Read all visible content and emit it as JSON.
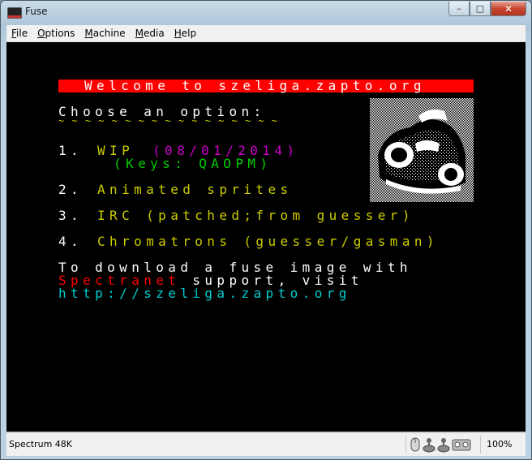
{
  "window": {
    "title": "Fuse",
    "controls": {
      "minimize": "–",
      "maximize": "□",
      "close": "✕"
    }
  },
  "menu": [
    {
      "label_first": "F",
      "label_rest": "ile"
    },
    {
      "label_first": "O",
      "label_rest": "ptions"
    },
    {
      "label_first": "M",
      "label_rest": "achine"
    },
    {
      "label_first": "M",
      "label_rest": "edia"
    },
    {
      "label_first": "H",
      "label_rest": "elp"
    }
  ],
  "screen": {
    "banner": "Welcome to szeliga.zapto.org",
    "prompt": "Choose an option:",
    "prompt_underline": "~~~~~~~~~~~~~~~~~",
    "options": [
      {
        "num": "1.",
        "label": "WIP",
        "date": "(08/01/2014)",
        "keys": "(Keys: QAOPM)"
      },
      {
        "num": "2.",
        "label": "Animated sprites"
      },
      {
        "num": "3.",
        "label": "IRC (patched;from guesser)"
      },
      {
        "num": "4.",
        "label": "Chromatrons (guesser/gasman)"
      }
    ],
    "footer_line1": "To download a fuse image with",
    "footer_spectranet": "Spectranet",
    "footer_line2_rest": " support, visit",
    "footer_url": "http://szeliga.zapto.org"
  },
  "colors": {
    "white": "#ffffff",
    "yellow": "#cdcd00",
    "magenta": "#cd00cd",
    "green": "#00cd00",
    "red": "#ff0000",
    "cyan": "#00cdcd"
  },
  "statusbar": {
    "model": "Spectrum 48K",
    "zoom": "100%",
    "icons": [
      "mouse-icon",
      "joystick-icon",
      "joystick-icon",
      "tape-icon"
    ]
  }
}
